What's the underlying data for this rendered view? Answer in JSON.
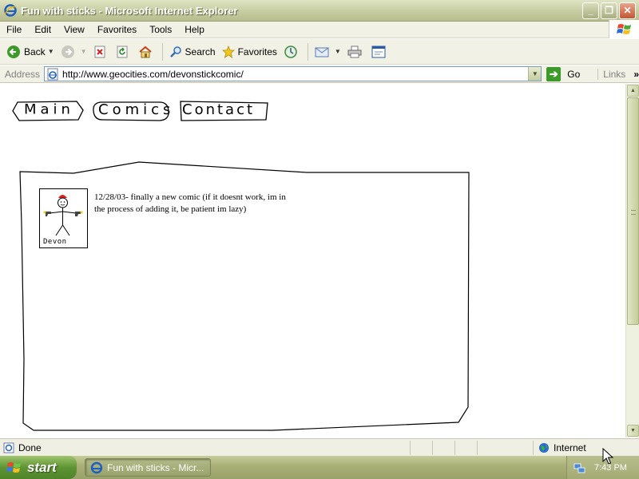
{
  "window": {
    "title": "Fun with sticks - Microsoft Internet Explorer",
    "buttons": {
      "minimize": "_",
      "maximize": "❐",
      "close": "✕"
    }
  },
  "menu": [
    "File",
    "Edit",
    "View",
    "Favorites",
    "Tools",
    "Help"
  ],
  "toolbar": {
    "back_label": "Back",
    "search_label": "Search",
    "favorites_label": "Favorites"
  },
  "address": {
    "label": "Address",
    "url": "http://www.geocities.com/devonstickcomic/",
    "go_label": "Go",
    "links_label": "Links",
    "links_chevron": "»"
  },
  "page": {
    "nav": [
      {
        "label": "Main"
      },
      {
        "label": "Comics"
      },
      {
        "label": "Contact"
      }
    ],
    "avatar_caption": "Devon",
    "post_text": "12/28/03- finally a new comic (if it doesnt work, im in the process of adding it, be patient im lazy)"
  },
  "status": {
    "text": "Done",
    "zone": "Internet"
  },
  "taskbar": {
    "start_label": "start",
    "task_label": "Fun with sticks - Micr...",
    "clock": "7:43 PM"
  },
  "colors": {
    "xp_olive_title": "#c9cfa4",
    "start_green": "#5f9433",
    "hat_red": "#e02020",
    "gun_yellow": "#f0d000"
  }
}
